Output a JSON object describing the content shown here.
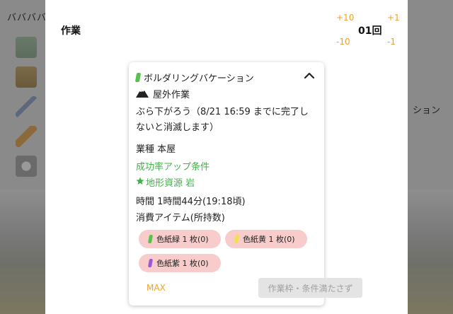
{
  "background": {
    "title": "ババババ",
    "right_text": "ション"
  },
  "modal": {
    "title": "作業",
    "counter": {
      "value": "01回",
      "plus10": "+10",
      "plus1": "+1",
      "minus10": "-10",
      "minus1": "-1"
    }
  },
  "job": {
    "name": "ボルダリングバケーション",
    "location": "屋外作業",
    "description": "ぶら下がろう（8/21 16:59 までに完了しないと消滅します）",
    "type": "業種 本屋",
    "condition_header": "成功率アップ条件",
    "condition_1": "地形資源 岩",
    "time": "時間 1時間44分(19:18頃)",
    "consume_label": "消費アイテム(所持数)",
    "items": [
      {
        "label": "色紙緑 1 枚(0)",
        "color": "#55c24a"
      },
      {
        "label": "色紙黄 1 枚(0)",
        "color": "#f2e04a"
      },
      {
        "label": "色紙紫 1 枚(0)",
        "color": "#9a5ad2"
      }
    ],
    "max_label": "MAX",
    "submit_label": "作業枠・条件満たさず"
  },
  "colors": {
    "accent_orange": "#f0a030",
    "green": "#42b04a",
    "chip_bg": "#f9cccc"
  }
}
